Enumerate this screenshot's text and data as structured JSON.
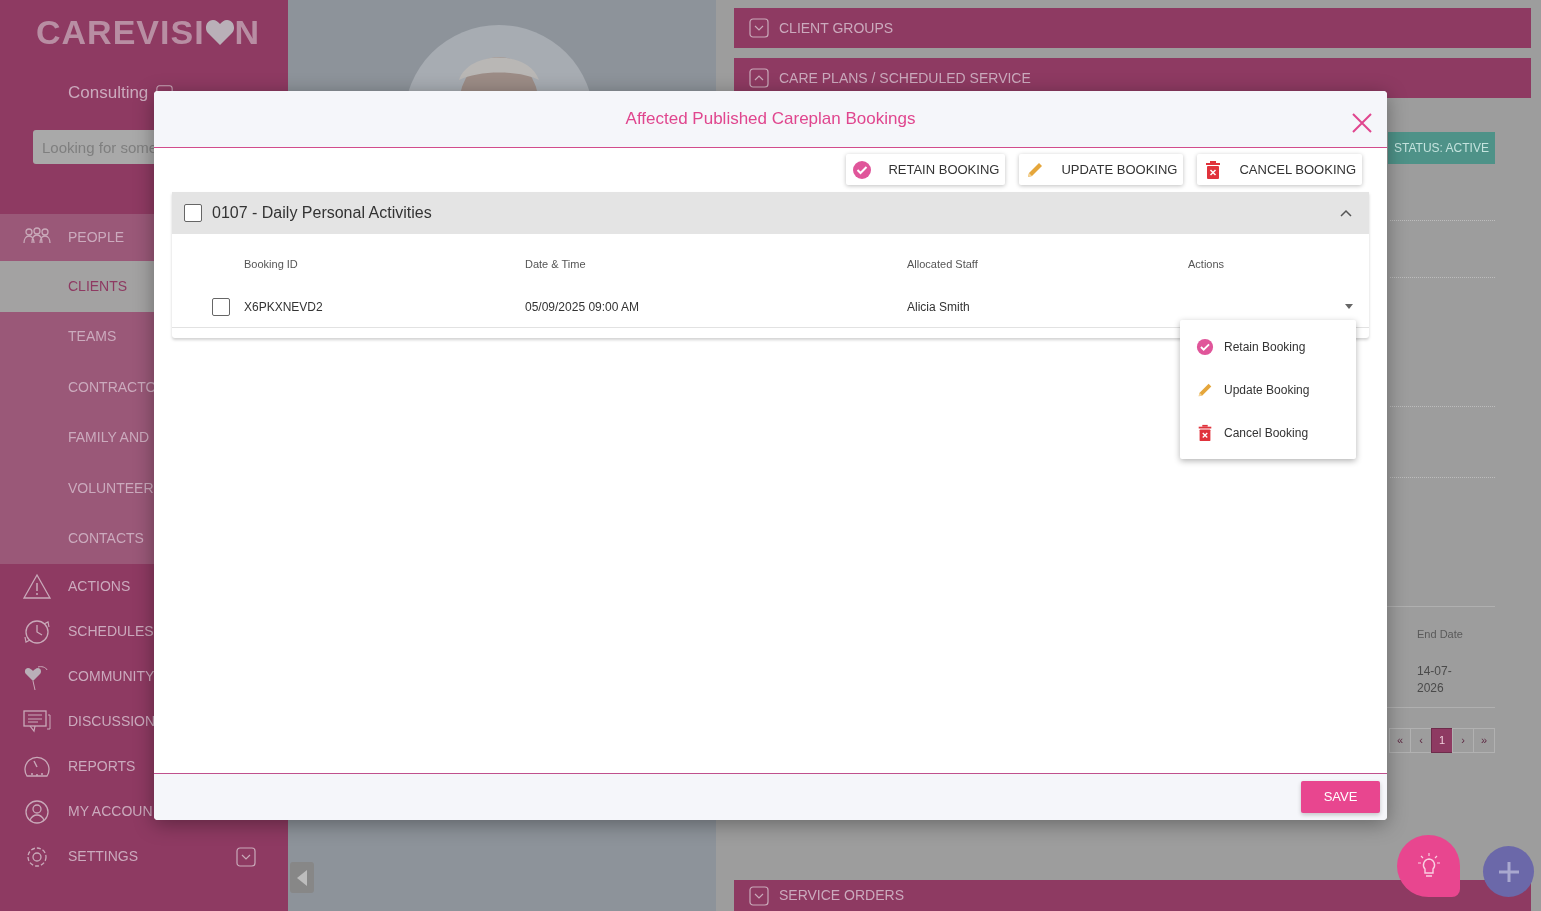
{
  "sidebar": {
    "logo": {
      "text": "CAREVISI",
      "tail": "N"
    },
    "org": "Consulting",
    "search": {
      "placeholder": "Looking for some"
    },
    "items": [
      {
        "label": "PEOPLE",
        "expanded": true,
        "children": [
          {
            "label": "CLIENTS",
            "selected": true
          },
          {
            "label": "TEAMS",
            "selected": false
          },
          {
            "label": "CONTRACTO",
            "selected": false
          },
          {
            "label": "FAMILY AND",
            "selected": false
          },
          {
            "label": "VOLUNTEER",
            "selected": false
          },
          {
            "label": "CONTACTS",
            "selected": false
          }
        ]
      },
      {
        "label": "ACTIONS"
      },
      {
        "label": "SCHEDULES"
      },
      {
        "label": "COMMUNITY"
      },
      {
        "label": "DISCUSSION"
      },
      {
        "label": "REPORTS"
      },
      {
        "label": "MY ACCOUN"
      },
      {
        "label": "SETTINGS",
        "expanded": false
      }
    ]
  },
  "sections": [
    {
      "title": "CLIENT GROUPS",
      "expanded": false
    },
    {
      "title": "CARE PLANS / SCHEDULED SERVICE",
      "expanded": true
    }
  ],
  "status_button": "STATUS: ACTIVE",
  "client_table": {
    "columns": [
      "End Date"
    ],
    "rows": [
      [
        "14-07-2026"
      ]
    ]
  },
  "pagination": [
    {
      "label": "«",
      "selected": false
    },
    {
      "label": "‹",
      "selected": false
    },
    {
      "label": "1",
      "selected": true
    },
    {
      "label": "›",
      "selected": false
    },
    {
      "label": "»",
      "selected": false
    }
  ],
  "bottom_section": {
    "title": "SERVICE ORDERS",
    "expanded": false
  },
  "modal": {
    "title": "Affected Published Careplan Bookings",
    "toolbar": [
      {
        "label": "RETAIN BOOKING",
        "kind": "retain"
      },
      {
        "label": "UPDATE BOOKING",
        "kind": "update"
      },
      {
        "label": "CANCEL BOOKING",
        "kind": "cancel"
      }
    ],
    "group": {
      "title": "0107 - Daily Personal Activities",
      "checked": false,
      "expanded": true
    },
    "columns": [
      "Booking ID",
      "Date & Time",
      "Allocated Staff",
      "Actions"
    ],
    "rows": [
      {
        "booking_id": "X6PKXNEVD2",
        "date_time": "05/09/2025 09:00 AM",
        "staff": "Alicia Smith",
        "checked": false
      }
    ],
    "actions_menu": {
      "open": true,
      "items": [
        {
          "label": "Retain Booking",
          "kind": "retain"
        },
        {
          "label": "Update Booking",
          "kind": "update"
        },
        {
          "label": "Cancel Booking",
          "kind": "cancel"
        }
      ]
    },
    "save": "SAVE"
  }
}
